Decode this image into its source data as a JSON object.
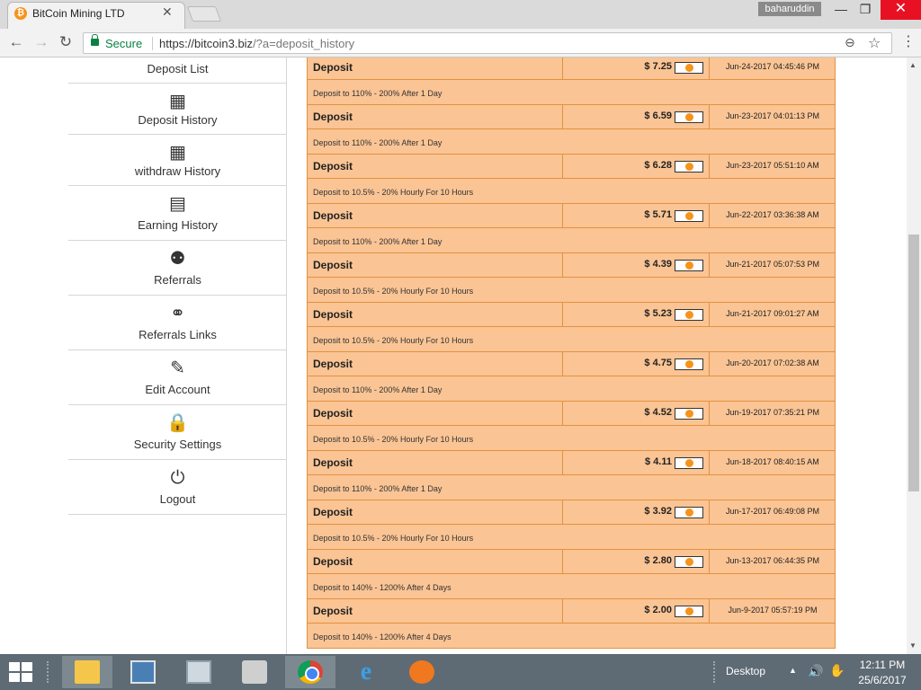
{
  "browser": {
    "tab_title": "BitCoin Mining LTD",
    "tab_favicon": "₿",
    "tab_close": "✕",
    "profile_name": "baharuddin",
    "window_min": "—",
    "window_max": "❐",
    "window_close": "✕",
    "secure_label": "Secure",
    "url_host": "https://bitcoin3.biz",
    "url_path": "/?a=deposit_history",
    "icons": [
      "lock-icon",
      "zoom-icon",
      "star-icon",
      "menu-icon"
    ]
  },
  "nav": {
    "back": "←",
    "forward": "→",
    "reload": "↻",
    "zoom": "⊖",
    "star": "☆",
    "menu": "⋮"
  },
  "sidebar": {
    "items": [
      {
        "label": "Deposit List",
        "icon": ""
      },
      {
        "label": "Deposit History",
        "icon": "▦"
      },
      {
        "label": "withdraw History",
        "icon": "▦"
      },
      {
        "label": "Earning History",
        "icon": "▤"
      },
      {
        "label": "Referrals",
        "icon": "⚉"
      },
      {
        "label": "Referrals Links",
        "icon": "⚭"
      },
      {
        "label": "Edit Account",
        "icon": "✎"
      },
      {
        "label": "Security Settings",
        "icon": "🔒"
      },
      {
        "label": "Logout",
        "icon": "⏻"
      }
    ]
  },
  "deposits": [
    {
      "type": "Deposit",
      "amount": "$ 7.25",
      "date": "Jun-24-2017 04:45:46 PM",
      "plan": "Deposit to 110% - 200% After 1 Day"
    },
    {
      "type": "Deposit",
      "amount": "$ 6.59",
      "date": "Jun-23-2017 04:01:13 PM",
      "plan": "Deposit to 110% - 200% After 1 Day"
    },
    {
      "type": "Deposit",
      "amount": "$ 6.28",
      "date": "Jun-23-2017 05:51:10 AM",
      "plan": "Deposit to 10.5% - 20% Hourly For 10 Hours"
    },
    {
      "type": "Deposit",
      "amount": "$ 5.71",
      "date": "Jun-22-2017 03:36:38 AM",
      "plan": "Deposit to 110% - 200% After 1 Day"
    },
    {
      "type": "Deposit",
      "amount": "$ 4.39",
      "date": "Jun-21-2017 05:07:53 PM",
      "plan": "Deposit to 10.5% - 20% Hourly For 10 Hours"
    },
    {
      "type": "Deposit",
      "amount": "$ 5.23",
      "date": "Jun-21-2017 09:01:27 AM",
      "plan": "Deposit to 10.5% - 20% Hourly For 10 Hours"
    },
    {
      "type": "Deposit",
      "amount": "$ 4.75",
      "date": "Jun-20-2017 07:02:38 AM",
      "plan": "Deposit to 110% - 200% After 1 Day"
    },
    {
      "type": "Deposit",
      "amount": "$ 4.52",
      "date": "Jun-19-2017 07:35:21 PM",
      "plan": "Deposit to 10.5% - 20% Hourly For 10 Hours"
    },
    {
      "type": "Deposit",
      "amount": "$ 4.11",
      "date": "Jun-18-2017 08:40:15 AM",
      "plan": "Deposit to 110% - 200% After 1 Day"
    },
    {
      "type": "Deposit",
      "amount": "$ 3.92",
      "date": "Jun-17-2017 06:49:08 PM",
      "plan": "Deposit to 10.5% - 20% Hourly For 10 Hours"
    },
    {
      "type": "Deposit",
      "amount": "$ 2.80",
      "date": "Jun-13-2017 06:44:35 PM",
      "plan": "Deposit to 140% - 1200% After 4 Days"
    },
    {
      "type": "Deposit",
      "amount": "$ 2.00",
      "date": "Jun-9-2017 05:57:19 PM",
      "plan": "Deposit to 140% - 1200% After 4 Days"
    }
  ],
  "colors": {
    "row_bg": "#fac494",
    "row_border": "#e3913f",
    "bitcoin": "#f7931a",
    "secure": "#0b8043",
    "taskbar": "#5e6b74"
  },
  "taskbar": {
    "apps": [
      "explorer-icon",
      "task-manager-icon",
      "performance-icon",
      "fax-icon",
      "chrome-icon",
      "ie-icon",
      "bars-app-icon"
    ],
    "desktop_label": "Desktop",
    "tray_up": "▲",
    "volume": "🔊",
    "hand": "✋",
    "time": "12:11 PM",
    "date": "25/6/2017"
  }
}
